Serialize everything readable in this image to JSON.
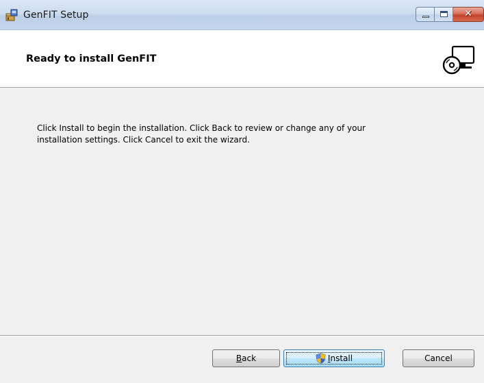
{
  "window": {
    "title": "GenFIT Setup",
    "icons": [
      "installer-app-icon",
      "minimize-icon",
      "maximize-icon",
      "close-icon"
    ]
  },
  "banner": {
    "title": "Ready to install GenFIT",
    "icon": "computer-install-icon"
  },
  "body": {
    "text_line1": "Click Install to begin the installation. Click Back to review or change any of your",
    "text_line2": "installation settings. Click Cancel to exit the wizard."
  },
  "buttons": {
    "back_mnemonic": "B",
    "back_rest": "ack",
    "install_mnemonic": "I",
    "install_rest": "nstall",
    "install_icon": "uac-shield-icon",
    "cancel_label": "Cancel"
  },
  "colors": {
    "window_bg": "#f0f0f0",
    "banner_bg": "#ffffff",
    "close_button": "#c4412a",
    "default_button_border": "#3c7fb1"
  }
}
